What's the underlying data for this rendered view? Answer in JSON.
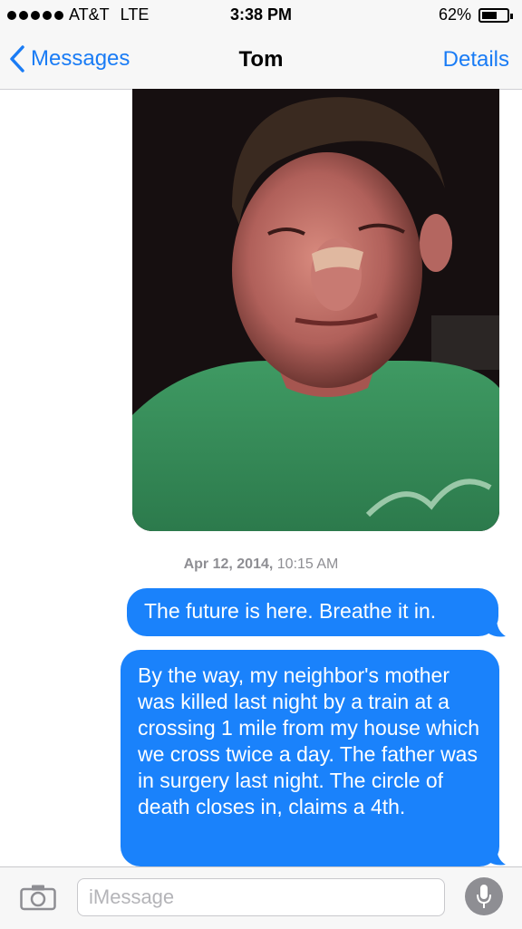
{
  "status_bar": {
    "carrier": "AT&T",
    "network": "LTE",
    "time": "3:38 PM",
    "battery": "62%",
    "battery_level": 0.62,
    "signal_dots": 5
  },
  "nav": {
    "back_label": "Messages",
    "title": "Tom",
    "details_label": "Details"
  },
  "photo": {
    "description_icon": "photo-attachment"
  },
  "timestamp": {
    "date": "Apr 12, 2014,",
    "time": "10:15 AM"
  },
  "messages": [
    {
      "text": "The future is here. Breathe it in.",
      "direction": "outgoing"
    },
    {
      "text": "By the way, my neighbor's mother was killed last night by a train at a crossing 1 mile from my house which we cross twice a day. The father was in surgery last night. The circle of death closes in, claims a 4th.",
      "direction": "outgoing"
    }
  ],
  "composer": {
    "placeholder": "iMessage",
    "camera_icon": "camera-icon",
    "mic_icon": "microphone-icon"
  },
  "colors": {
    "accent": "#1a7cf5",
    "bubble_blue": "#1a82fb",
    "bar_bg": "#f7f7f7",
    "timestamp_gray": "#8e8e93"
  }
}
